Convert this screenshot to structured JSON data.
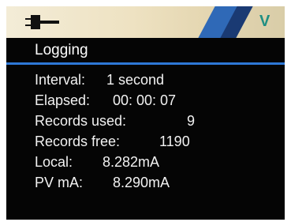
{
  "status_bar": {
    "plug_icon": "plug-icon",
    "mode_letter": "V",
    "stripe_colors": [
      "#2f69b7",
      "#1a3a73"
    ],
    "mode_color": "#1f8f82"
  },
  "screen": {
    "title": "Logging",
    "divider_color": "#2e78d6"
  },
  "logging": {
    "interval_label": "Interval:",
    "interval_value": "1 second",
    "elapsed_label": "Elapsed:",
    "elapsed_value": "00: 00: 07",
    "records_used_label": "Records used:",
    "records_used_value": "9",
    "records_free_label": "Records free:",
    "records_free_value": "1190",
    "local_label": "Local:",
    "local_value": "8.282mA",
    "pv_label": "PV mA:",
    "pv_value": "8.290mA"
  }
}
